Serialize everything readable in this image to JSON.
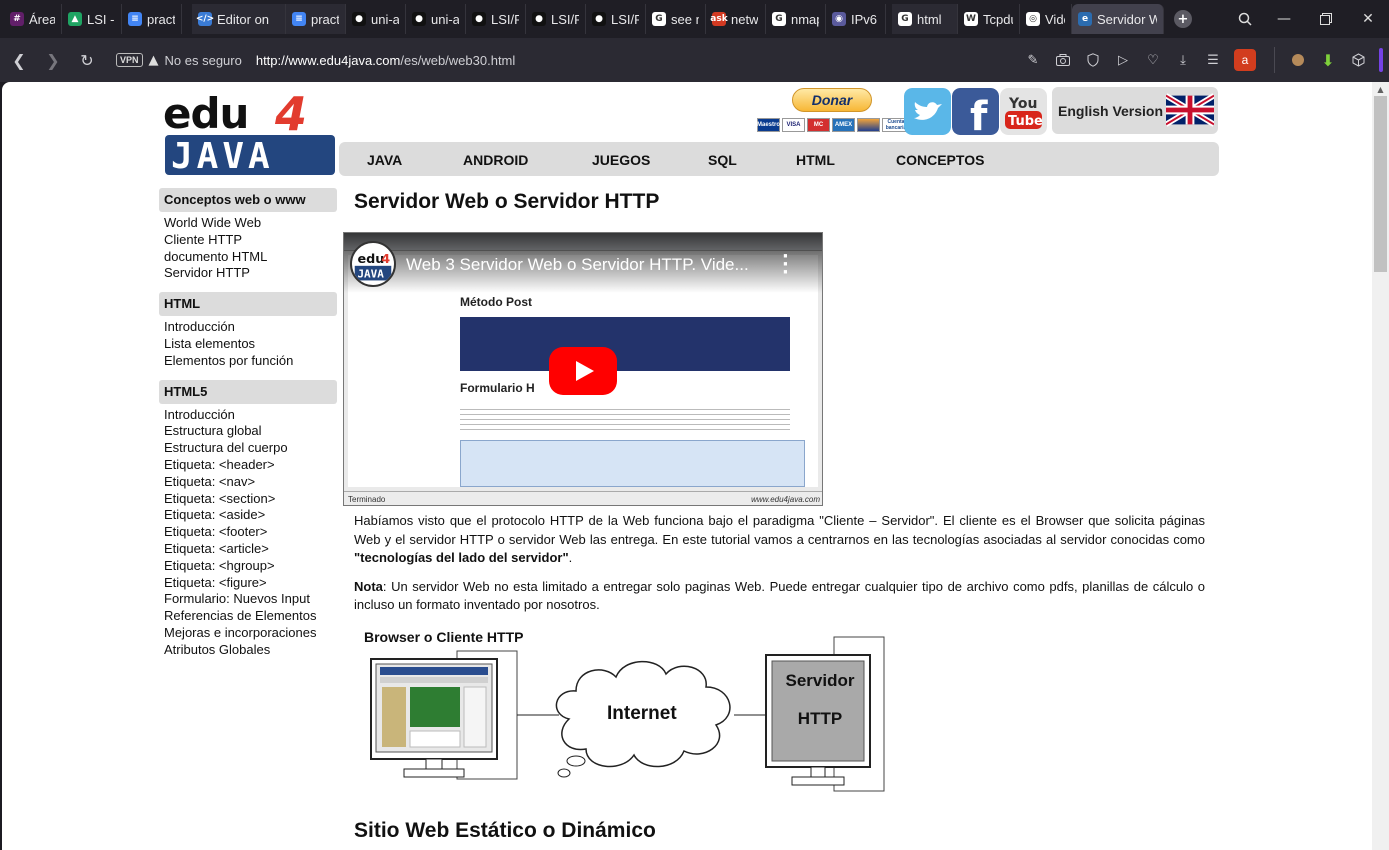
{
  "browser": {
    "tabs": [
      {
        "label": "Área p",
        "icon": "slack-icon",
        "color": "#611f69"
      },
      {
        "label": "LSI - C",
        "icon": "google-drive-icon",
        "color": "#1fa463"
      },
      {
        "label": "practi",
        "icon": "google-docs-icon",
        "color": "#4285f4"
      },
      {
        "label": "Editor on",
        "icon": "code-editor-icon",
        "color": "#3a7bd5"
      },
      {
        "label": "practi",
        "icon": "google-docs-icon",
        "color": "#4285f4"
      },
      {
        "label": "uni-a",
        "icon": "github-icon",
        "color": "#111111"
      },
      {
        "label": "uni-a",
        "icon": "github-icon",
        "color": "#111111"
      },
      {
        "label": "LSI/P",
        "icon": "github-icon",
        "color": "#111111"
      },
      {
        "label": "LSI/P",
        "icon": "github-icon",
        "color": "#111111"
      },
      {
        "label": "LSI/P",
        "icon": "github-icon",
        "color": "#111111"
      },
      {
        "label": "see n",
        "icon": "google-icon",
        "color": "#ffffff"
      },
      {
        "label": "netw",
        "icon": "ask-icon",
        "color": "#d33a22"
      },
      {
        "label": "nmap",
        "icon": "google-icon",
        "color": "#ffffff"
      },
      {
        "label": "IPv6",
        "icon": "eye-icon",
        "color": "#5a5a9c"
      },
      {
        "label": "html",
        "icon": "google-icon",
        "color": "#ffffff"
      },
      {
        "label": "Tcpdu",
        "icon": "wikipedia-icon",
        "color": "#ffffff"
      },
      {
        "label": "Video",
        "icon": "globe-icon",
        "color": "#ffffff"
      },
      {
        "label": "Servidor W",
        "icon": "edu4java-icon",
        "color": "#2b6cb0"
      }
    ],
    "new_tab": "+",
    "address": {
      "vpn": "VPN",
      "security": "No es seguro",
      "url_domain": "http://www.edu4java.com",
      "url_path": "/es/web/web30.html"
    },
    "extension_letter": "a"
  },
  "site": {
    "donate_label": "Donar",
    "cards": [
      "Maestro",
      "VISA",
      "MC",
      "AMEX",
      "",
      "Cuenta bancaria"
    ],
    "language_label": "English Version",
    "menu": [
      "JAVA",
      "ANDROID",
      "JUEGOS",
      "SQL",
      "HTML",
      "CONCEPTOS"
    ],
    "sidebar": [
      {
        "title": "Conceptos web o www",
        "items": [
          "World Wide Web",
          "Cliente HTTP",
          "documento HTML",
          "Servidor HTTP"
        ]
      },
      {
        "title": "HTML",
        "items": [
          "Introducción",
          "Lista elementos",
          "Elementos por función"
        ]
      },
      {
        "title": "HTML5",
        "items": [
          "Introducción",
          "Estructura global",
          "Estructura del cuerpo",
          "Etiqueta: <header>",
          "Etiqueta: <nav>",
          "Etiqueta: <section>",
          "Etiqueta: <aside>",
          "Etiqueta: <footer>",
          "Etiqueta: <article>",
          "Etiqueta: <hgroup>",
          "Etiqueta: <figure>",
          "Formulario: Nuevos Input",
          "Referencias de Elementos",
          "Mejoras e incorporaciones",
          "Atributos Globales"
        ]
      }
    ],
    "title": "Servidor Web o Servidor HTTP",
    "video": {
      "title": "Web 3 Servidor Web o Servidor HTTP. Vide...",
      "heading1": "Método Post",
      "heading2": "Formulario H",
      "status_left": "Terminado",
      "status_right": "www.edu4java.com"
    },
    "para1_a": "Habíamos visto que el protocolo HTTP de la Web funciona bajo el paradigma \"Cliente – Servidor\". El cliente es el Browser que solicita páginas Web y el servidor HTTP o servidor Web las entrega. En este tutorial vamos a centrarnos en las tecnologías asociadas al servidor conocidas como ",
    "para1_b": "\"tecnologías del lado del servidor\"",
    "para1_c": ".",
    "para2_a": "Nota",
    "para2_b": ": Un servidor Web no esta limitado a entregar solo paginas Web. Puede entregar cualquier tipo de archivo como pdfs, planillas de cálculo o incluso un formato inventado por nosotros.",
    "diagram": {
      "client_label": "Browser o Cliente HTTP",
      "cloud_label": "Internet",
      "server_line1": "Servidor",
      "server_line2": "HTTP"
    },
    "subtitle": "Sitio Web Estático o Dinámico"
  }
}
